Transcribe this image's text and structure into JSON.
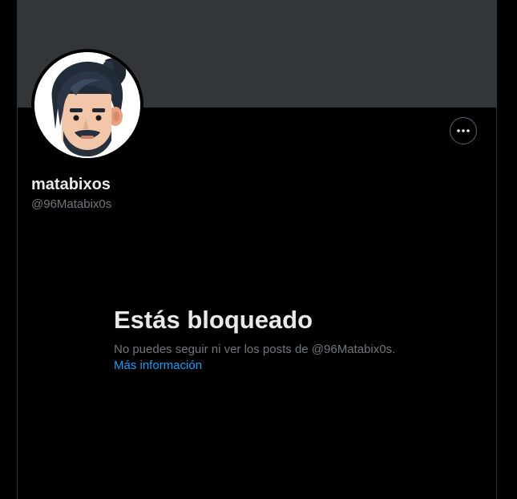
{
  "profile": {
    "display_name": "matabixos",
    "handle": "@96Matabix0s",
    "avatar_icon": "cartoon-avatar-icon",
    "more_icon": "more-options-icon"
  },
  "blocked": {
    "title": "Estás bloqueado",
    "message": "No puedes seguir ni ver los posts de @96Matabix0s.",
    "link": "Más información"
  },
  "colors": {
    "background": "#000000",
    "banner": "#333639",
    "primary_text": "#e7e9ea",
    "secondary_text": "#71767b",
    "link": "#1d9bf0",
    "border": "#2f3336"
  }
}
